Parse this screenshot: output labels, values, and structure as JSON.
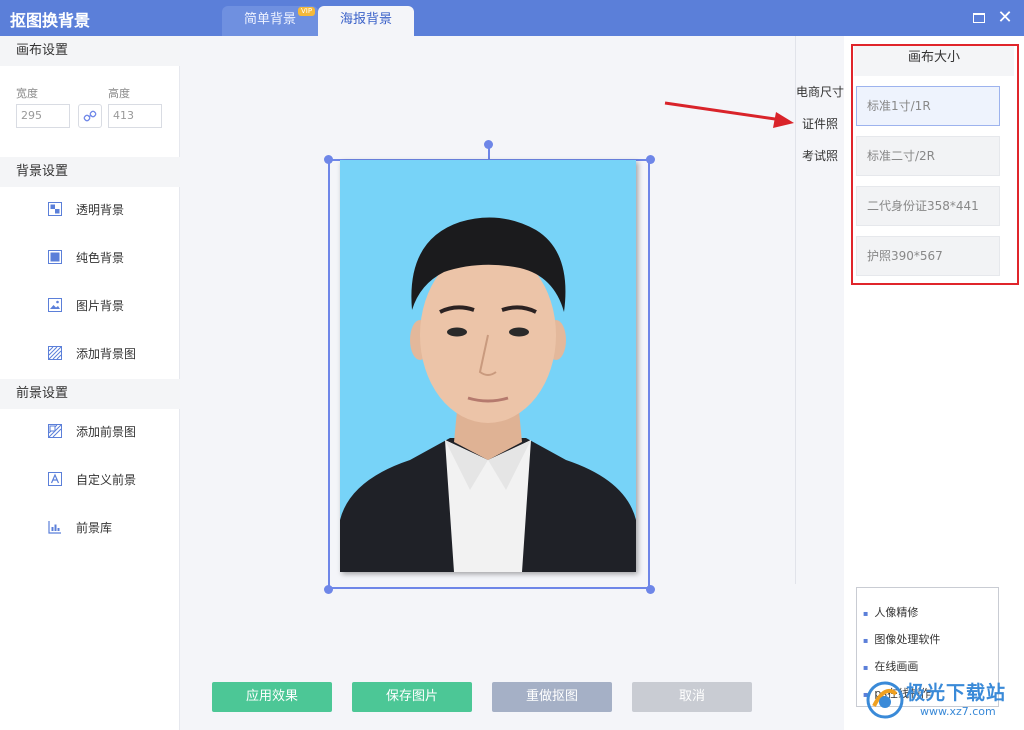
{
  "app": {
    "title": "抠图换背景"
  },
  "tabs": [
    {
      "label": "简单背景",
      "badge": "VIP"
    },
    {
      "label": "海报背景"
    }
  ],
  "left": {
    "canvas_section": "画布设置",
    "width_label": "宽度",
    "height_label": "高度",
    "width_value": "295",
    "height_value": "413",
    "bg_section": "背景设置",
    "bg_items": [
      {
        "label": "透明背景",
        "icon": "transparent-icon"
      },
      {
        "label": "纯色背景",
        "icon": "solid-color-icon"
      },
      {
        "label": "图片背景",
        "icon": "image-icon"
      },
      {
        "label": "添加背景图",
        "icon": "add-pattern-icon"
      }
    ],
    "fg_section": "前景设置",
    "fg_items": [
      {
        "label": "添加前景图",
        "icon": "add-foreground-icon"
      },
      {
        "label": "自定义前景",
        "icon": "text-a-icon"
      },
      {
        "label": "前景库",
        "icon": "library-icon"
      }
    ]
  },
  "categories": [
    "电商尺寸",
    "证件照",
    "考试照"
  ],
  "size_panel": {
    "title": "画布大小",
    "options": [
      "标准1寸/1R",
      "标准二寸/2R",
      "二代身份证358*441",
      "护照390*567"
    ]
  },
  "buttons": {
    "apply": "应用效果",
    "save": "保存图片",
    "redo": "重做抠图",
    "cancel": "取消"
  },
  "links": [
    "人像精修",
    "图像处理软件",
    "在线画画",
    "ps在线制作"
  ],
  "watermark": {
    "text": "极光下载站",
    "url": "www.xz7.com"
  },
  "colors": {
    "titlebar": "#5b7fd9",
    "photo_bg": "#77d3f8",
    "green": "#4cc796",
    "accent": "#6e86e8",
    "highlight": "#e0252b"
  }
}
